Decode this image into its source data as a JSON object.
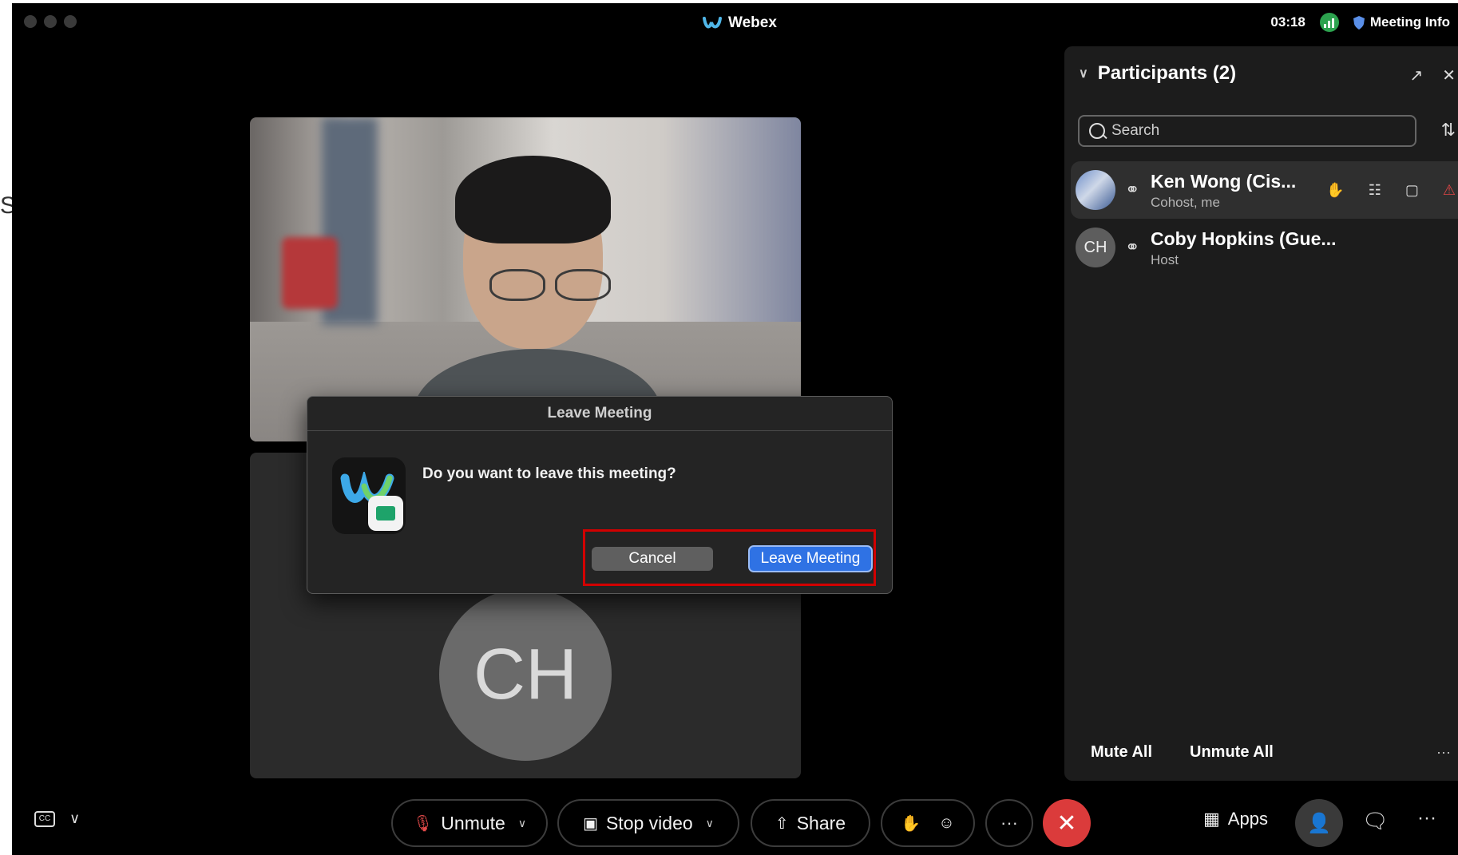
{
  "window": {
    "title": "Webex",
    "timer": "03:18",
    "meeting_info": "Meeting Info",
    "edge_fragment": "S"
  },
  "tile": {
    "ch_initials": "CH"
  },
  "dialog": {
    "title": "Leave Meeting",
    "question": "Do you want to leave this meeting?",
    "cancel": "Cancel",
    "confirm": "Leave Meeting"
  },
  "participants": {
    "title": "Participants (2)",
    "search_placeholder": "Search",
    "list": [
      {
        "name": "Ken Wong (Cis...",
        "role": "Cohost, me"
      },
      {
        "name": "Coby Hopkins (Gue...",
        "role": "Host",
        "initials": "CH"
      }
    ],
    "mute_all": "Mute All",
    "unmute_all": "Unmute All",
    "more": "···"
  },
  "toolbar": {
    "unmute": "Unmute",
    "stop_video": "Stop video",
    "share": "Share",
    "more": "···",
    "apps": "Apps",
    "end_more": "···"
  },
  "colors": {
    "accent_blue": "#2f72e4",
    "end_red": "#db3b3b",
    "highlight_red": "#d20000",
    "signal_green": "#2ca24e"
  },
  "icons": {
    "reactions": "smile-plus-icon",
    "raise_hand": "hand-icon",
    "chat": "chat-bubble-icon",
    "captions": "closed-captions-icon"
  }
}
